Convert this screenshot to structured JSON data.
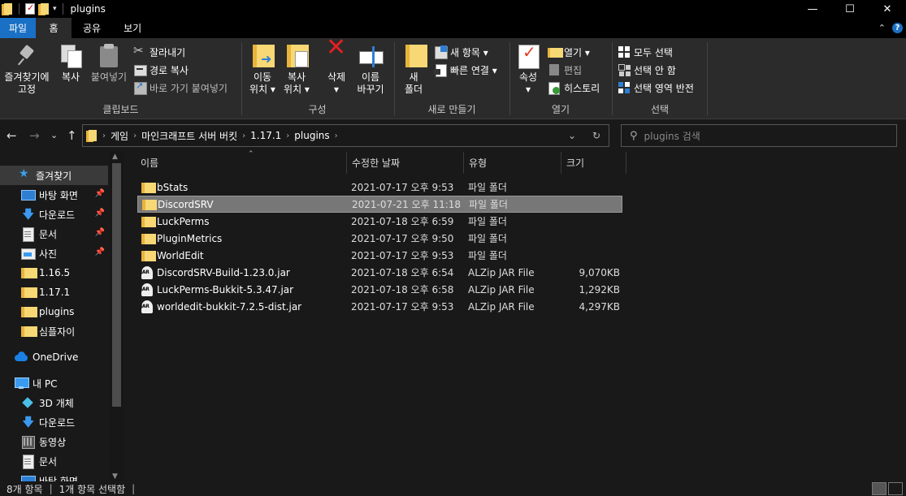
{
  "window": {
    "title": "plugins",
    "controls": {
      "minimize": "—",
      "maximize": "☐",
      "close": "✕"
    }
  },
  "ribbon_tabs": [
    "파일",
    "홈",
    "공유",
    "보기"
  ],
  "ribbon": {
    "clipboard": {
      "label": "클립보드",
      "pin": "즐겨찾기에\n고정",
      "pin_line1": "즐겨찾기에",
      "pin_line2": "고정",
      "copy": "복사",
      "paste": "붙여넣기",
      "cut": "잘라내기",
      "copy_path": "경로 복사",
      "paste_shortcut": "바로 가기 붙여넣기"
    },
    "organize": {
      "label": "구성",
      "move_line1": "이동",
      "move_line2": "위치 ▾",
      "copy_line1": "복사",
      "copy_line2": "위치 ▾",
      "delete": "삭제",
      "delete_arrow": "▾",
      "rename_line1": "이름",
      "rename_line2": "바꾸기"
    },
    "new": {
      "label": "새로 만들기",
      "folder_line1": "새",
      "folder_line2": "폴더",
      "new_item": "새 항목 ▾",
      "easy_access": "빠른 연결 ▾"
    },
    "open": {
      "label": "열기",
      "properties": "속성",
      "properties_arrow": "▾",
      "open": "열기 ▾",
      "edit": "편집",
      "history": "히스토리"
    },
    "select": {
      "label": "선택",
      "select_all": "모두 선택",
      "select_none": "선택 안 함",
      "invert": "선택 영역 반전"
    }
  },
  "address": {
    "breadcrumbs": [
      "게임",
      "마인크래프트 서버 버킷",
      "1.17.1",
      "plugins"
    ],
    "search_placeholder": "plugins 검색",
    "dropdown": "⌄",
    "refresh": "↻"
  },
  "nav": {
    "back": "←",
    "forward": "→",
    "recent": "⌄",
    "up": "↑"
  },
  "navpane": [
    {
      "label": "즐겨찾기",
      "icon": "star-icon",
      "pinned": false
    },
    {
      "label": "바탕 화면",
      "icon": "desktop-icon",
      "pinned": true
    },
    {
      "label": "다운로드",
      "icon": "download-icon",
      "pinned": true
    },
    {
      "label": "문서",
      "icon": "document-icon",
      "pinned": true
    },
    {
      "label": "사진",
      "icon": "pictures-icon",
      "pinned": true
    },
    {
      "label": "1.16.5",
      "icon": "folder-icon",
      "pinned": false
    },
    {
      "label": "1.17.1",
      "icon": "folder-icon",
      "pinned": false
    },
    {
      "label": "plugins",
      "icon": "folder-icon",
      "pinned": false
    },
    {
      "label": "심플자이",
      "icon": "folder-icon",
      "pinned": false
    },
    {
      "label": "OneDrive",
      "icon": "onedrive-icon",
      "pinned": false
    },
    {
      "label": "내 PC",
      "icon": "pc-icon",
      "pinned": false
    },
    {
      "label": "3D 개체",
      "icon": "3d-objects-icon",
      "pinned": false
    },
    {
      "label": "다운로드",
      "icon": "download-icon",
      "pinned": false
    },
    {
      "label": "동영상",
      "icon": "video-icon",
      "pinned": false
    },
    {
      "label": "문서",
      "icon": "document-icon",
      "pinned": false
    },
    {
      "label": "바탕 화면",
      "icon": "desktop-icon",
      "pinned": false
    }
  ],
  "columns": {
    "name": "이름",
    "date": "수정한 날짜",
    "type": "유형",
    "size": "크기"
  },
  "files": [
    {
      "name": "bStats",
      "date": "2021-07-17 오후 9:53",
      "type": "파일 폴더",
      "size": "",
      "kind": "folder"
    },
    {
      "name": "DiscordSRV",
      "date": "2021-07-21 오후 11:18",
      "type": "파일 폴더",
      "size": "",
      "kind": "folder",
      "selected": true
    },
    {
      "name": "LuckPerms",
      "date": "2021-07-18 오후 6:59",
      "type": "파일 폴더",
      "size": "",
      "kind": "folder"
    },
    {
      "name": "PluginMetrics",
      "date": "2021-07-17 오후 9:50",
      "type": "파일 폴더",
      "size": "",
      "kind": "folder"
    },
    {
      "name": "WorldEdit",
      "date": "2021-07-17 오후 9:53",
      "type": "파일 폴더",
      "size": "",
      "kind": "folder"
    },
    {
      "name": "DiscordSRV-Build-1.23.0.jar",
      "date": "2021-07-18 오후 6:54",
      "type": "ALZip JAR File",
      "size": "9,070KB",
      "kind": "jar"
    },
    {
      "name": "LuckPerms-Bukkit-5.3.47.jar",
      "date": "2021-07-18 오후 6:58",
      "type": "ALZip JAR File",
      "size": "1,292KB",
      "kind": "jar"
    },
    {
      "name": "worldedit-bukkit-7.2.5-dist.jar",
      "date": "2021-07-17 오후 9:53",
      "type": "ALZip JAR File",
      "size": "4,297KB",
      "kind": "jar"
    }
  ],
  "status": {
    "count": "8개 항목",
    "selected": "1개 항목 선택함"
  },
  "colors": {
    "accent": "#1a70c4",
    "folder": "#f8d775",
    "selection": "#777777"
  }
}
